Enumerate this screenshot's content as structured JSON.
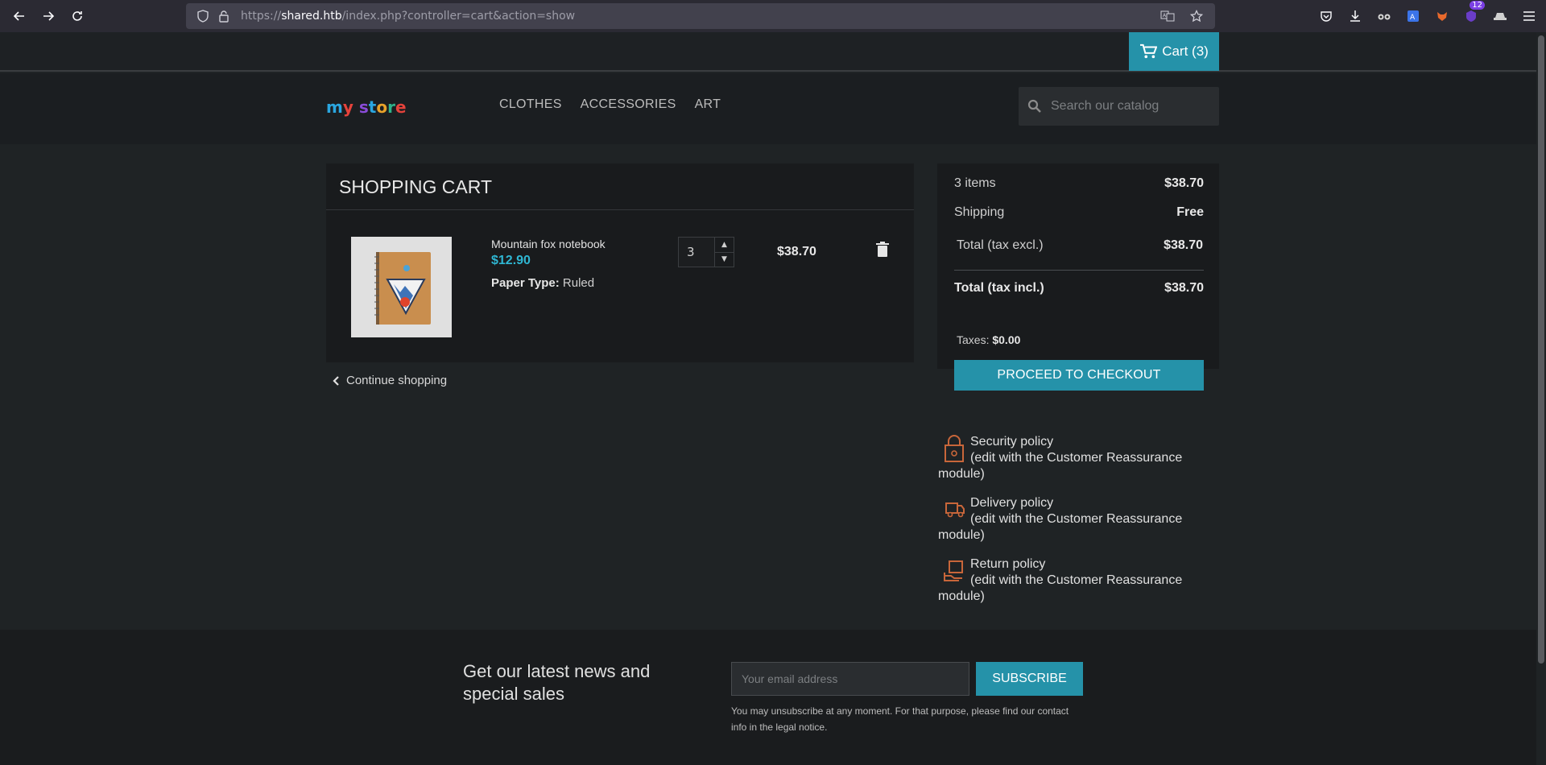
{
  "browser": {
    "url_prefix": "https://",
    "url_host": "shared.htb",
    "url_path": "/index.php?controller=cart&action=show",
    "extension_badge": "12"
  },
  "header": {
    "cart_label": "Cart (3)",
    "logo_text": "my store",
    "nav": [
      "CLOTHES",
      "ACCESSORIES",
      "ART"
    ],
    "search_placeholder": "Search our catalog"
  },
  "cart": {
    "title": "SHOPPING CART",
    "item": {
      "name": "Mountain fox notebook",
      "price": "$12.90",
      "attr_key": "Paper Type:",
      "attr_value": "Ruled",
      "quantity": "3",
      "total": "$38.70"
    },
    "continue_label": "Continue shopping"
  },
  "summary": {
    "items_label": "3 items",
    "items_value": "$38.70",
    "shipping_label": "Shipping",
    "shipping_value": "Free",
    "tax_excl_label": "Total (tax excl.)",
    "tax_excl_value": "$38.70",
    "tax_incl_label": "Total (tax incl.)",
    "tax_incl_value": "$38.70",
    "taxes_label": "Taxes:",
    "taxes_value": "$0.00",
    "checkout_label": "PROCEED TO CHECKOUT"
  },
  "reassurance": [
    {
      "title": "Security policy",
      "desc": "(edit with the Customer Reassurance module)",
      "icon": "lock-icon"
    },
    {
      "title": "Delivery policy",
      "desc": "(edit with the Customer Reassurance module)",
      "icon": "truck-icon"
    },
    {
      "title": "Return policy",
      "desc": "(edit with the Customer Reassurance module)",
      "icon": "return-box-icon"
    }
  ],
  "newsletter": {
    "title": "Get our latest news and special sales",
    "email_placeholder": "Your email address",
    "subscribe_label": "SUBSCRIBE",
    "note": "You may unsubscribe at any moment. For that purpose, please find our contact info in the legal notice."
  },
  "colors": {
    "accent": "#2592a9",
    "price": "#2fb6d2",
    "icon_orange": "#c8663a"
  }
}
